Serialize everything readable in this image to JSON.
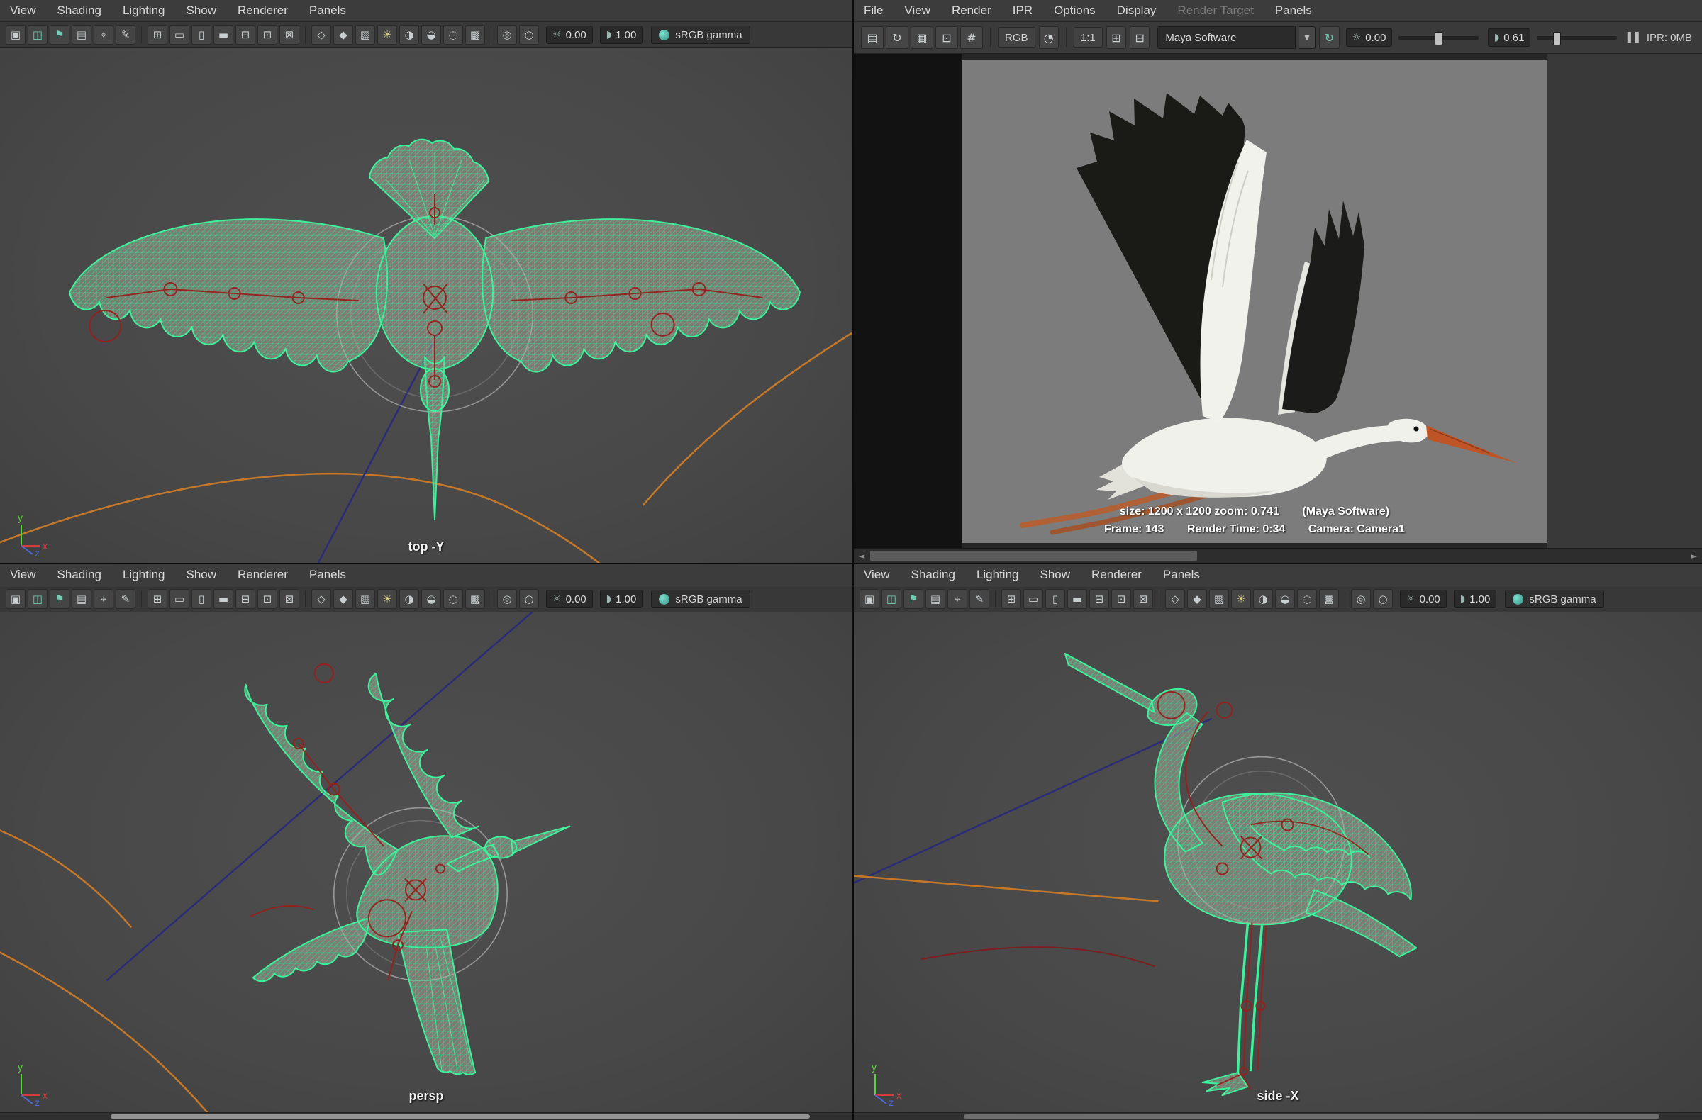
{
  "colors": {
    "wireframe_green": "#3df29b",
    "skeleton_red": "#96201c",
    "motion_trail_orange": "#c67829",
    "trail_blue": "#2b2b78",
    "beak_orange": "#bf5526",
    "accent_teal": "#49b8a8",
    "viewport_gray": "#4a4a4a",
    "render_bg_gray": "#7c7c7c"
  },
  "viewport_menus": [
    "View",
    "Shading",
    "Lighting",
    "Show",
    "Renderer",
    "Panels"
  ],
  "viewport_toolbar": {
    "icons": [
      {
        "name": "select-camera-icon",
        "glyph": "▣"
      },
      {
        "name": "lock-camera-icon",
        "glyph": "◫",
        "color": "#74cdb4"
      },
      {
        "name": "bookmark-icon",
        "glyph": "⚑",
        "color": "#74cdb4"
      },
      {
        "name": "image-plane-icon",
        "glyph": "▤"
      },
      {
        "name": "two-d-pan-zoom-icon",
        "glyph": "⌖"
      },
      {
        "name": "grease-pencil-icon",
        "glyph": "✎"
      },
      {
        "sep": true
      },
      {
        "name": "grid-icon",
        "glyph": "⊞"
      },
      {
        "name": "film-gate-icon",
        "glyph": "▭"
      },
      {
        "name": "resolution-gate-icon",
        "glyph": "▯"
      },
      {
        "name": "gate-mask-icon",
        "glyph": "▬"
      },
      {
        "name": "field-chart-icon",
        "glyph": "⊟"
      },
      {
        "name": "safe-action-icon",
        "glyph": "⊡"
      },
      {
        "name": "safe-title-icon",
        "glyph": "⊠"
      },
      {
        "sep": true
      },
      {
        "name": "wireframe-icon",
        "glyph": "◇"
      },
      {
        "name": "smooth-shade-icon",
        "glyph": "◆"
      },
      {
        "name": "textured-icon",
        "glyph": "▧"
      },
      {
        "name": "use-all-lights-icon",
        "glyph": "☀",
        "color": "#d6c87e"
      },
      {
        "name": "shadows-icon",
        "glyph": "◑"
      },
      {
        "name": "ambient-occlusion-icon",
        "glyph": "◒"
      },
      {
        "name": "motion-blur-icon",
        "glyph": "◌"
      },
      {
        "name": "anti-alias-icon",
        "glyph": "▩"
      },
      {
        "sep": true
      },
      {
        "name": "isolate-select-icon",
        "glyph": "◎"
      },
      {
        "name": "xray-icon",
        "glyph": "○"
      }
    ],
    "exposure_icon_glyph": "☼",
    "exposure": "0.00",
    "gamma_icon_glyph": "◗",
    "gamma": "1.00",
    "colorspace": "sRGB gamma"
  },
  "viewports": {
    "top": {
      "label": "top -Y"
    },
    "persp": {
      "label": "persp"
    },
    "side": {
      "label": "side -X"
    }
  },
  "axis_labels": {
    "x": "x",
    "y": "y",
    "z": "z"
  },
  "render_view": {
    "menus": [
      {
        "name": "menu-file",
        "label": "File"
      },
      {
        "name": "menu-view",
        "label": "View"
      },
      {
        "name": "menu-render",
        "label": "Render"
      },
      {
        "name": "menu-ipr",
        "label": "IPR"
      },
      {
        "name": "menu-options",
        "label": "Options"
      },
      {
        "name": "menu-display",
        "label": "Display"
      },
      {
        "name": "menu-render-target",
        "label": "Render Target",
        "disabled": true
      },
      {
        "name": "menu-panels",
        "label": "Panels"
      }
    ],
    "toolbar": {
      "left_icons": [
        {
          "name": "render-frame-icon",
          "glyph": "▤"
        },
        {
          "name": "redo-previous-render-icon",
          "glyph": "↻"
        },
        {
          "name": "ipr-render-icon",
          "glyph": "▦"
        },
        {
          "name": "render-region-icon",
          "glyph": "⊡"
        },
        {
          "name": "snapshot-icon",
          "glyph": "#"
        }
      ],
      "rgb_label": "RGB",
      "alpha_icon_glyph": "◔",
      "ratio_label": "1:1",
      "keep_image_glyph": "⊞",
      "remove_image_glyph": "⊟",
      "renderer_select": "Maya Software",
      "dropdown_arrow_glyph": "▼",
      "refresh_glyph": "↻",
      "exposure_icon_glyph": "☼",
      "exposure_value": "0.00",
      "contrast_glyph": "◗",
      "contrast_value": "0.61",
      "pause_glyph": "▌▌",
      "ipr_memory": "IPR: 0MB"
    },
    "status": {
      "size": "size: 1200 x 1200 zoom: 0.741",
      "renderer": "(Maya Software)",
      "frame": "Frame: 143",
      "render_time": "Render Time: 0:34",
      "camera": "Camera: Camera1"
    },
    "scroll_left_glyph": "◄",
    "scroll_right_glyph": "►"
  }
}
